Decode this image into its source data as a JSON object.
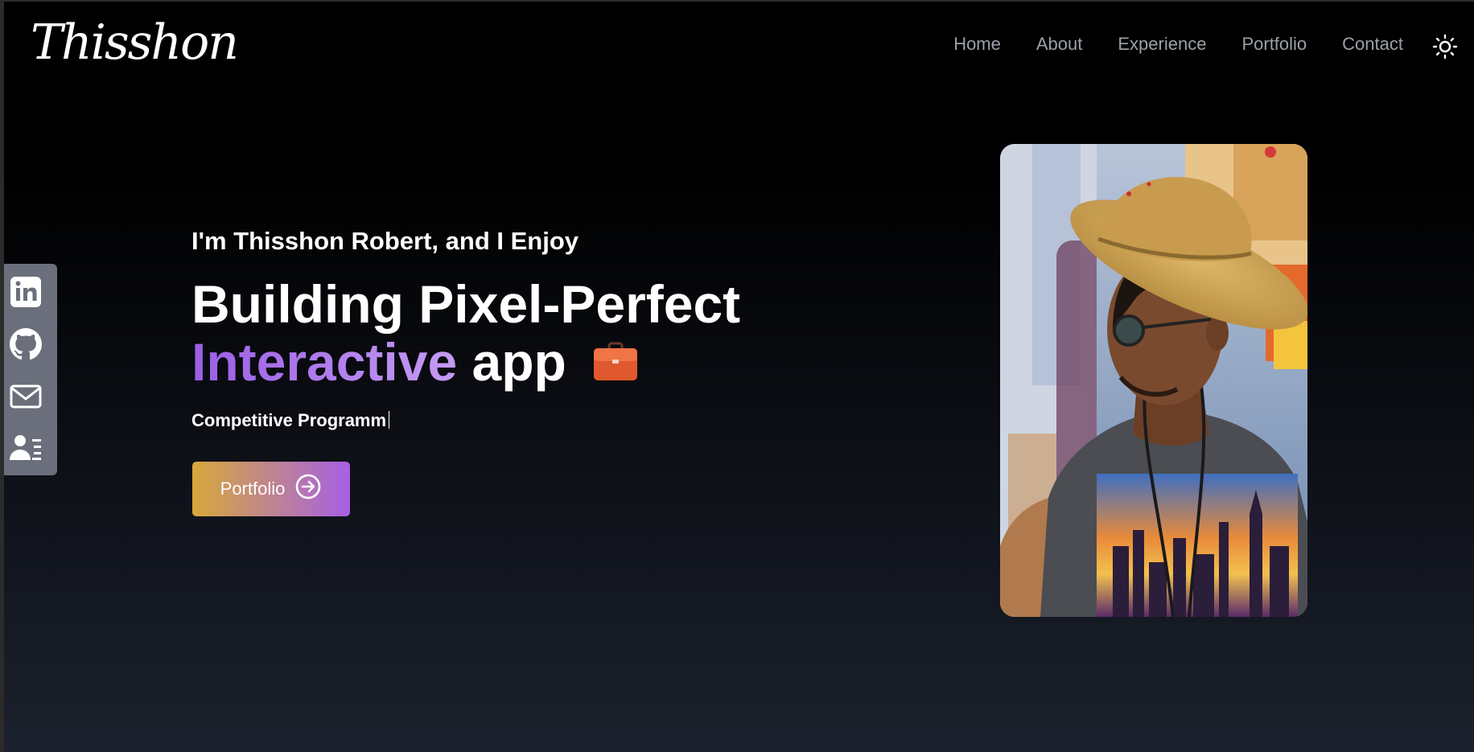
{
  "header": {
    "logo": "Thisshon",
    "nav": [
      "Home",
      "About",
      "Experience",
      "Portfolio",
      "Contact"
    ],
    "theme_toggle_icon": "sun-icon"
  },
  "social": {
    "icons": [
      "linkedin-icon",
      "github-icon",
      "mail-icon",
      "contact-card-icon"
    ]
  },
  "hero": {
    "intro": "I'm Thisshon Robert, and I Enjoy",
    "headline_line1": "Building Pixel-Perfect",
    "headline_accent": "Interactive",
    "headline_rest": "app",
    "typed_text": "Competitive Programm",
    "button_label": "Portfolio",
    "button_icon": "arrow-right-circle-icon"
  },
  "colors": {
    "accent_purple": "#9b5de5",
    "button_gradient_start": "#d7a83a",
    "button_gradient_end": "#a660e6",
    "sidebar_bg": "#6b6f7b",
    "nav_text": "#9aa0a8"
  }
}
